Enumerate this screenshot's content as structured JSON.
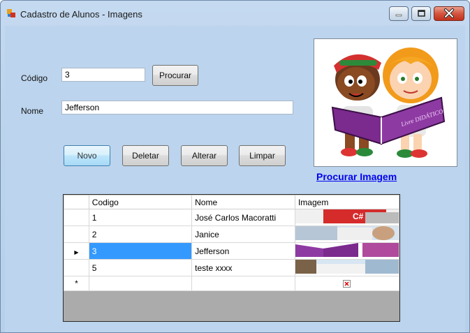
{
  "window": {
    "title": "Cadastro de Alunos - Imagens"
  },
  "form": {
    "codigo_label": "Código",
    "codigo_value": "3",
    "search_button": "Procurar",
    "nome_label": "Nome",
    "nome_value": "Jefferson"
  },
  "buttons": {
    "novo": "Novo",
    "deletar": "Deletar",
    "alterar": "Alterar",
    "limpar": "Limpar"
  },
  "image_panel": {
    "link": "Procurar Imagem",
    "book_text": "Livre DIDÁTICO"
  },
  "grid": {
    "columns": [
      "Codigo",
      "Nome",
      "Imagem"
    ],
    "rows": [
      {
        "codigo": "1",
        "nome": "José Carlos Macoratti"
      },
      {
        "codigo": "2",
        "nome": "Janice"
      },
      {
        "codigo": "3",
        "nome": "Jefferson",
        "selected": true
      },
      {
        "codigo": "5",
        "nome": "teste xxxx"
      }
    ],
    "new_row_marker": "*",
    "current_row_marker": "▶",
    "thumb_text": "C#"
  },
  "colors": {
    "selection": "#3399ff",
    "link": "#0000ee"
  }
}
